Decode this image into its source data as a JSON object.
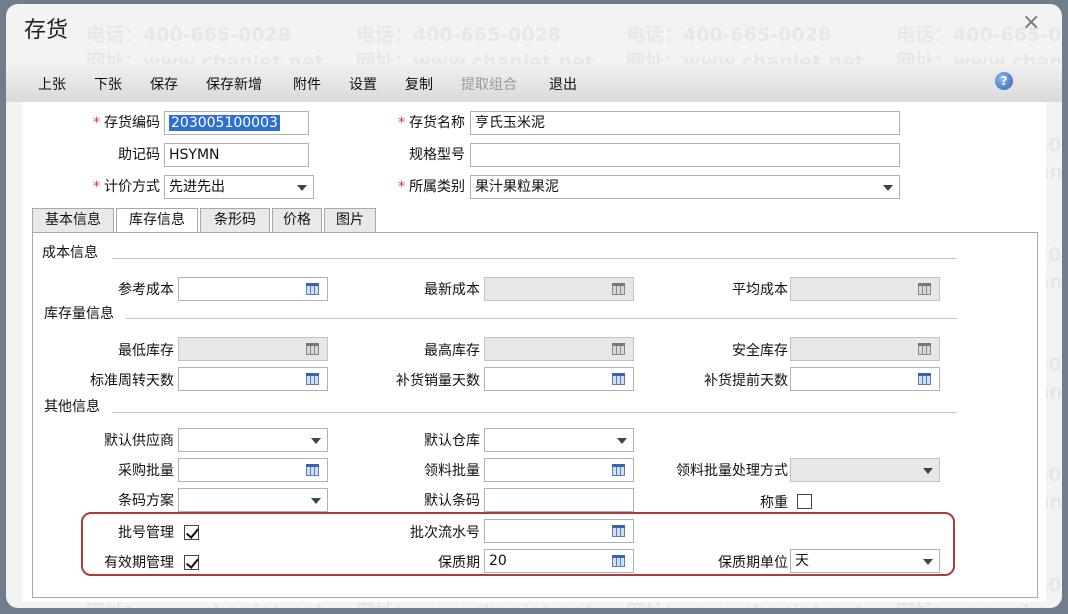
{
  "window": {
    "title": "存货",
    "close_glyph": "×"
  },
  "toolbar": {
    "items": [
      "上张",
      "下张",
      "保存",
      "保存新增",
      "附件",
      "设置",
      "复制",
      "提取组合",
      "退出"
    ],
    "disabled_item": "提取组合",
    "help_glyph": "?"
  },
  "header": {
    "code_label": "存货编码",
    "code_value": "203005100003",
    "name_label": "存货名称",
    "name_value": "亨氏玉米泥",
    "mnemonic_label": "助记码",
    "mnemonic_value": "HSYMN",
    "spec_label": "规格型号",
    "spec_value": "",
    "pricing_label": "计价方式",
    "pricing_value": "先进先出",
    "category_label": "所属类别",
    "category_value": "果汁果粒果泥",
    "required_mark": "*"
  },
  "tabs": [
    "基本信息",
    "库存信息",
    "条形码",
    "价格",
    "图片"
  ],
  "active_tab": "库存信息",
  "cost": {
    "section": "成本信息",
    "ref_label": "参考成本",
    "latest_label": "最新成本",
    "avg_label": "平均成本"
  },
  "stock": {
    "section": "库存量信息",
    "min_label": "最低库存",
    "max_label": "最高库存",
    "safety_label": "安全库存",
    "turnover_label": "标准周转天数",
    "replenish_qty_label": "补货销量天数",
    "lead_label": "补货提前天数"
  },
  "other": {
    "section": "其他信息",
    "supplier_label": "默认供应商",
    "warehouse_label": "默认仓库",
    "purchase_batch_label": "采购批量",
    "issue_batch_label": "领料批量",
    "issue_method_label": "领料批量处理方式",
    "barcode_scheme_label": "条码方案",
    "default_barcode_label": "默认条码",
    "weigh_label": "称重",
    "batch_mgmt_label": "批号管理",
    "batch_serial_label": "批次流水号",
    "expiry_mgmt_label": "有效期管理",
    "shelf_life_label": "保质期",
    "shelf_life_value": "20",
    "shelf_unit_label": "保质期单位",
    "shelf_unit_value": "天"
  },
  "watermark": {
    "phone": "电话：400-665-0028",
    "site": "网址：www.chanjet.net"
  }
}
